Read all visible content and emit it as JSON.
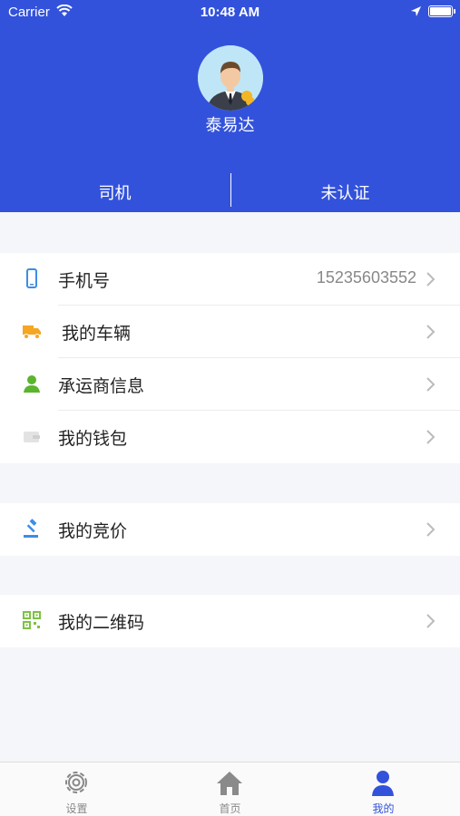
{
  "status_bar": {
    "carrier": "Carrier",
    "time": "10:48 AM"
  },
  "profile": {
    "name": "泰易达",
    "role": "司机",
    "certification": "未认证"
  },
  "groups": [
    [
      {
        "label": "手机号",
        "value": "15235603552",
        "icon": "phone-icon"
      },
      {
        "label": "我的车辆",
        "icon": "truck-icon"
      },
      {
        "label": "承运商信息",
        "icon": "person-icon"
      },
      {
        "label": "我的钱包",
        "icon": "wallet-icon"
      }
    ],
    [
      {
        "label": "我的竞价",
        "icon": "gavel-icon"
      }
    ],
    [
      {
        "label": "我的二维码",
        "icon": "qrcode-icon"
      }
    ]
  ],
  "tabbar": {
    "settings": "设置",
    "home": "首页",
    "mine": "我的"
  },
  "colors": {
    "header": "#3352db",
    "active_tab": "#3352db"
  }
}
